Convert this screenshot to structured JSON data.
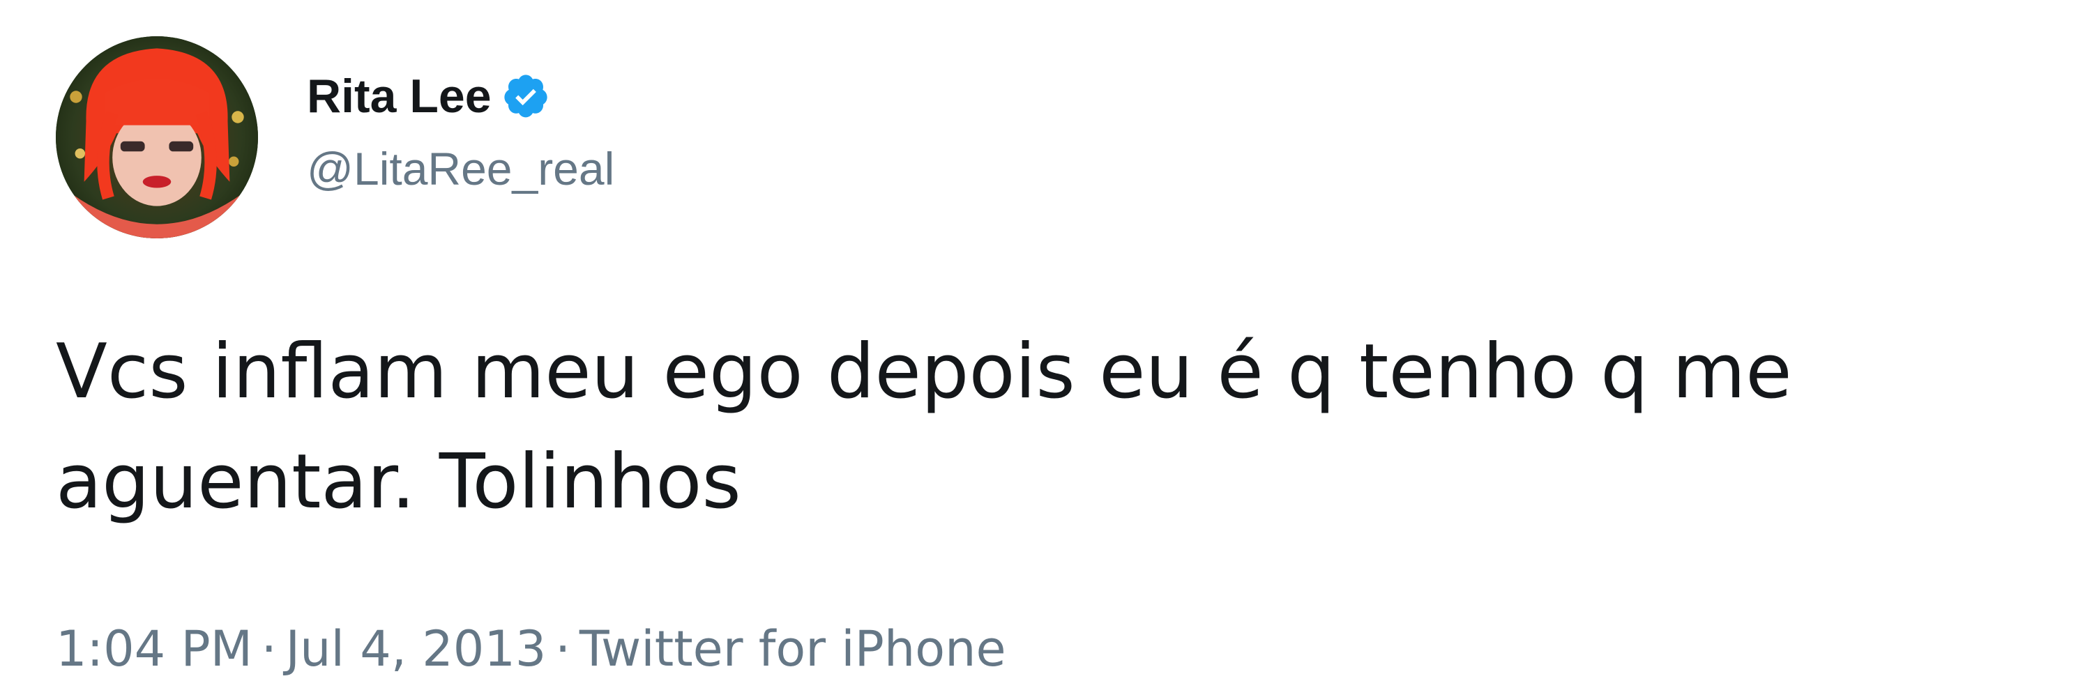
{
  "tweet": {
    "author": {
      "display_name": "Rita Lee",
      "handle": "@LitaRee_real",
      "verified": true,
      "avatar_icon": "profile-photo-red-hair"
    },
    "text": "Vcs inflam meu ego depois eu é q tenho q me\naguentar. Tolinhos",
    "time": "1:04 PM",
    "date": "Jul 4, 2013",
    "source": "Twitter for iPhone",
    "separator": "·"
  },
  "colors": {
    "text_primary": "#14171a",
    "text_secondary": "#657786",
    "verified_badge": "#1da1f2",
    "background": "#ffffff"
  }
}
